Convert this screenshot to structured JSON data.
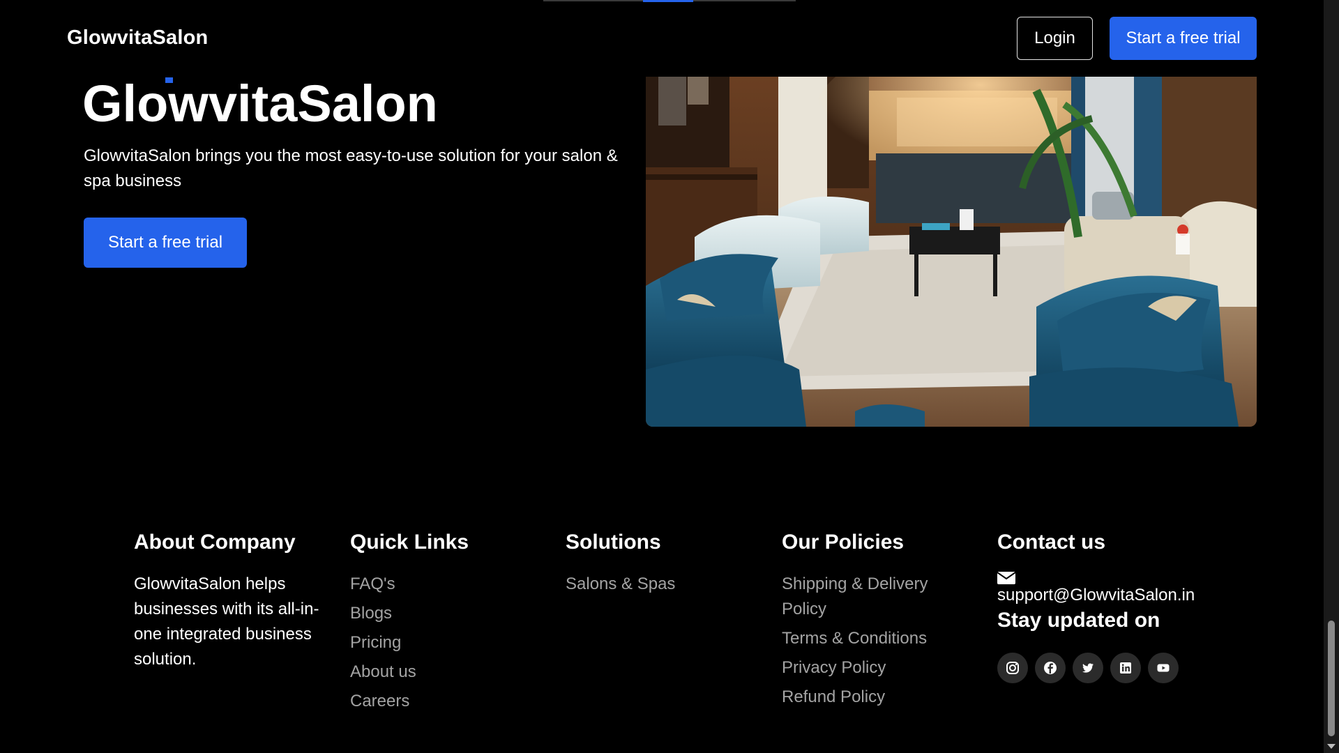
{
  "header": {
    "logo": "GlowvitaSalon",
    "login_label": "Login",
    "trial_label": "Start a free trial"
  },
  "hero": {
    "title": "GlowvitaSalon",
    "description": "GlowvitaSalon brings you the most easy-to-use solution for your salon & spa business",
    "cta_label": "Start a free trial",
    "image_icon": "salon-lounge-image"
  },
  "footer": {
    "about": {
      "heading": "About Company",
      "text": "GlowvitaSalon helps businesses with its all-in-one integrated business solution."
    },
    "quick_links": {
      "heading": "Quick Links",
      "items": [
        "FAQ's",
        "Blogs",
        "Pricing",
        "About us",
        "Careers"
      ]
    },
    "solutions": {
      "heading": "Solutions",
      "items": [
        "Salons & Spas"
      ]
    },
    "policies": {
      "heading": "Our Policies",
      "items": [
        "Shipping & Delivery Policy",
        "Terms & Conditions",
        "Privacy Policy",
        "Refund Policy"
      ]
    },
    "contact": {
      "heading": "Contact us",
      "email_icon": "envelope-icon",
      "email": "support@GlowvitaSalon.in",
      "stay_heading": "Stay updated on",
      "socials": [
        "instagram-icon",
        "facebook-icon",
        "twitter-icon",
        "linkedin-icon",
        "youtube-icon"
      ]
    }
  },
  "colors": {
    "accent": "#2563eb",
    "background": "#000000",
    "link": "#a3a3a3",
    "social_bg": "#2b2b2b"
  }
}
